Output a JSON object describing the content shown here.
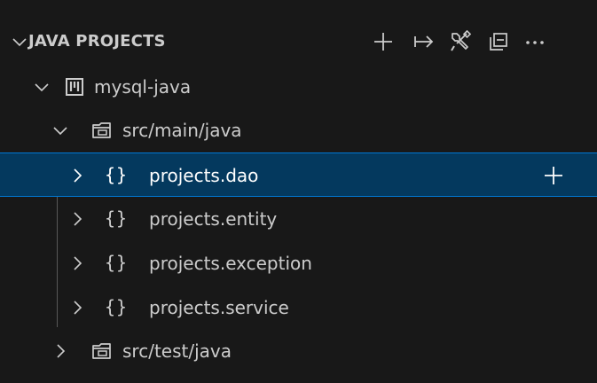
{
  "header": {
    "title": "JAVA PROJECTS",
    "actions": [
      "new-project",
      "link-with-editor",
      "tools",
      "collapse-all",
      "more-actions"
    ]
  },
  "tree": {
    "project": {
      "label": "mysql-java"
    },
    "folder_main": {
      "label": "src/main/java"
    },
    "packages": [
      {
        "label": "projects.dao",
        "icon": "{}"
      },
      {
        "label": "projects.entity",
        "icon": "{}"
      },
      {
        "label": "projects.exception",
        "icon": "{}"
      },
      {
        "label": "projects.service",
        "icon": "{}"
      }
    ],
    "folder_test": {
      "label": "src/test/java"
    }
  },
  "colors": {
    "background": "#181818",
    "selection_bg": "#04395e",
    "selection_border": "#0078d4",
    "text": "#cccccc",
    "selected_text": "#ffffff"
  }
}
